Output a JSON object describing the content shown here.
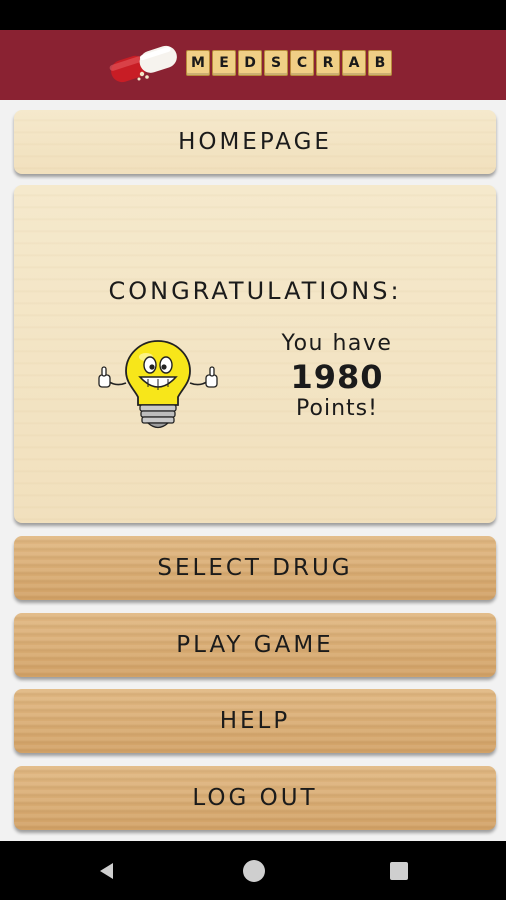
{
  "app": {
    "logo_letters": [
      "M",
      "E",
      "D",
      "S",
      "C",
      "R",
      "A",
      "B"
    ]
  },
  "menu": {
    "homepage": "HOMEPAGE",
    "select_drug": "SELECT DRUG",
    "play_game": "PLAY GAME",
    "help": "HELP",
    "log_out": "LOG OUT"
  },
  "result": {
    "heading": "CONGRATULATIONS:",
    "line1": "You have",
    "points": "1980",
    "line2": "Points!",
    "mascot_icon": "smiling-lightbulb-thumbs-up"
  },
  "nav": {
    "back_icon": "triangle-back-icon",
    "home_icon": "circle-home-icon",
    "recent_icon": "square-recent-apps-icon"
  },
  "colors": {
    "header_bg": "#8a2232",
    "tile_bg": "#f0cf86",
    "panel_bg": "#f4e6c6",
    "button_wood": "#dbb078"
  }
}
